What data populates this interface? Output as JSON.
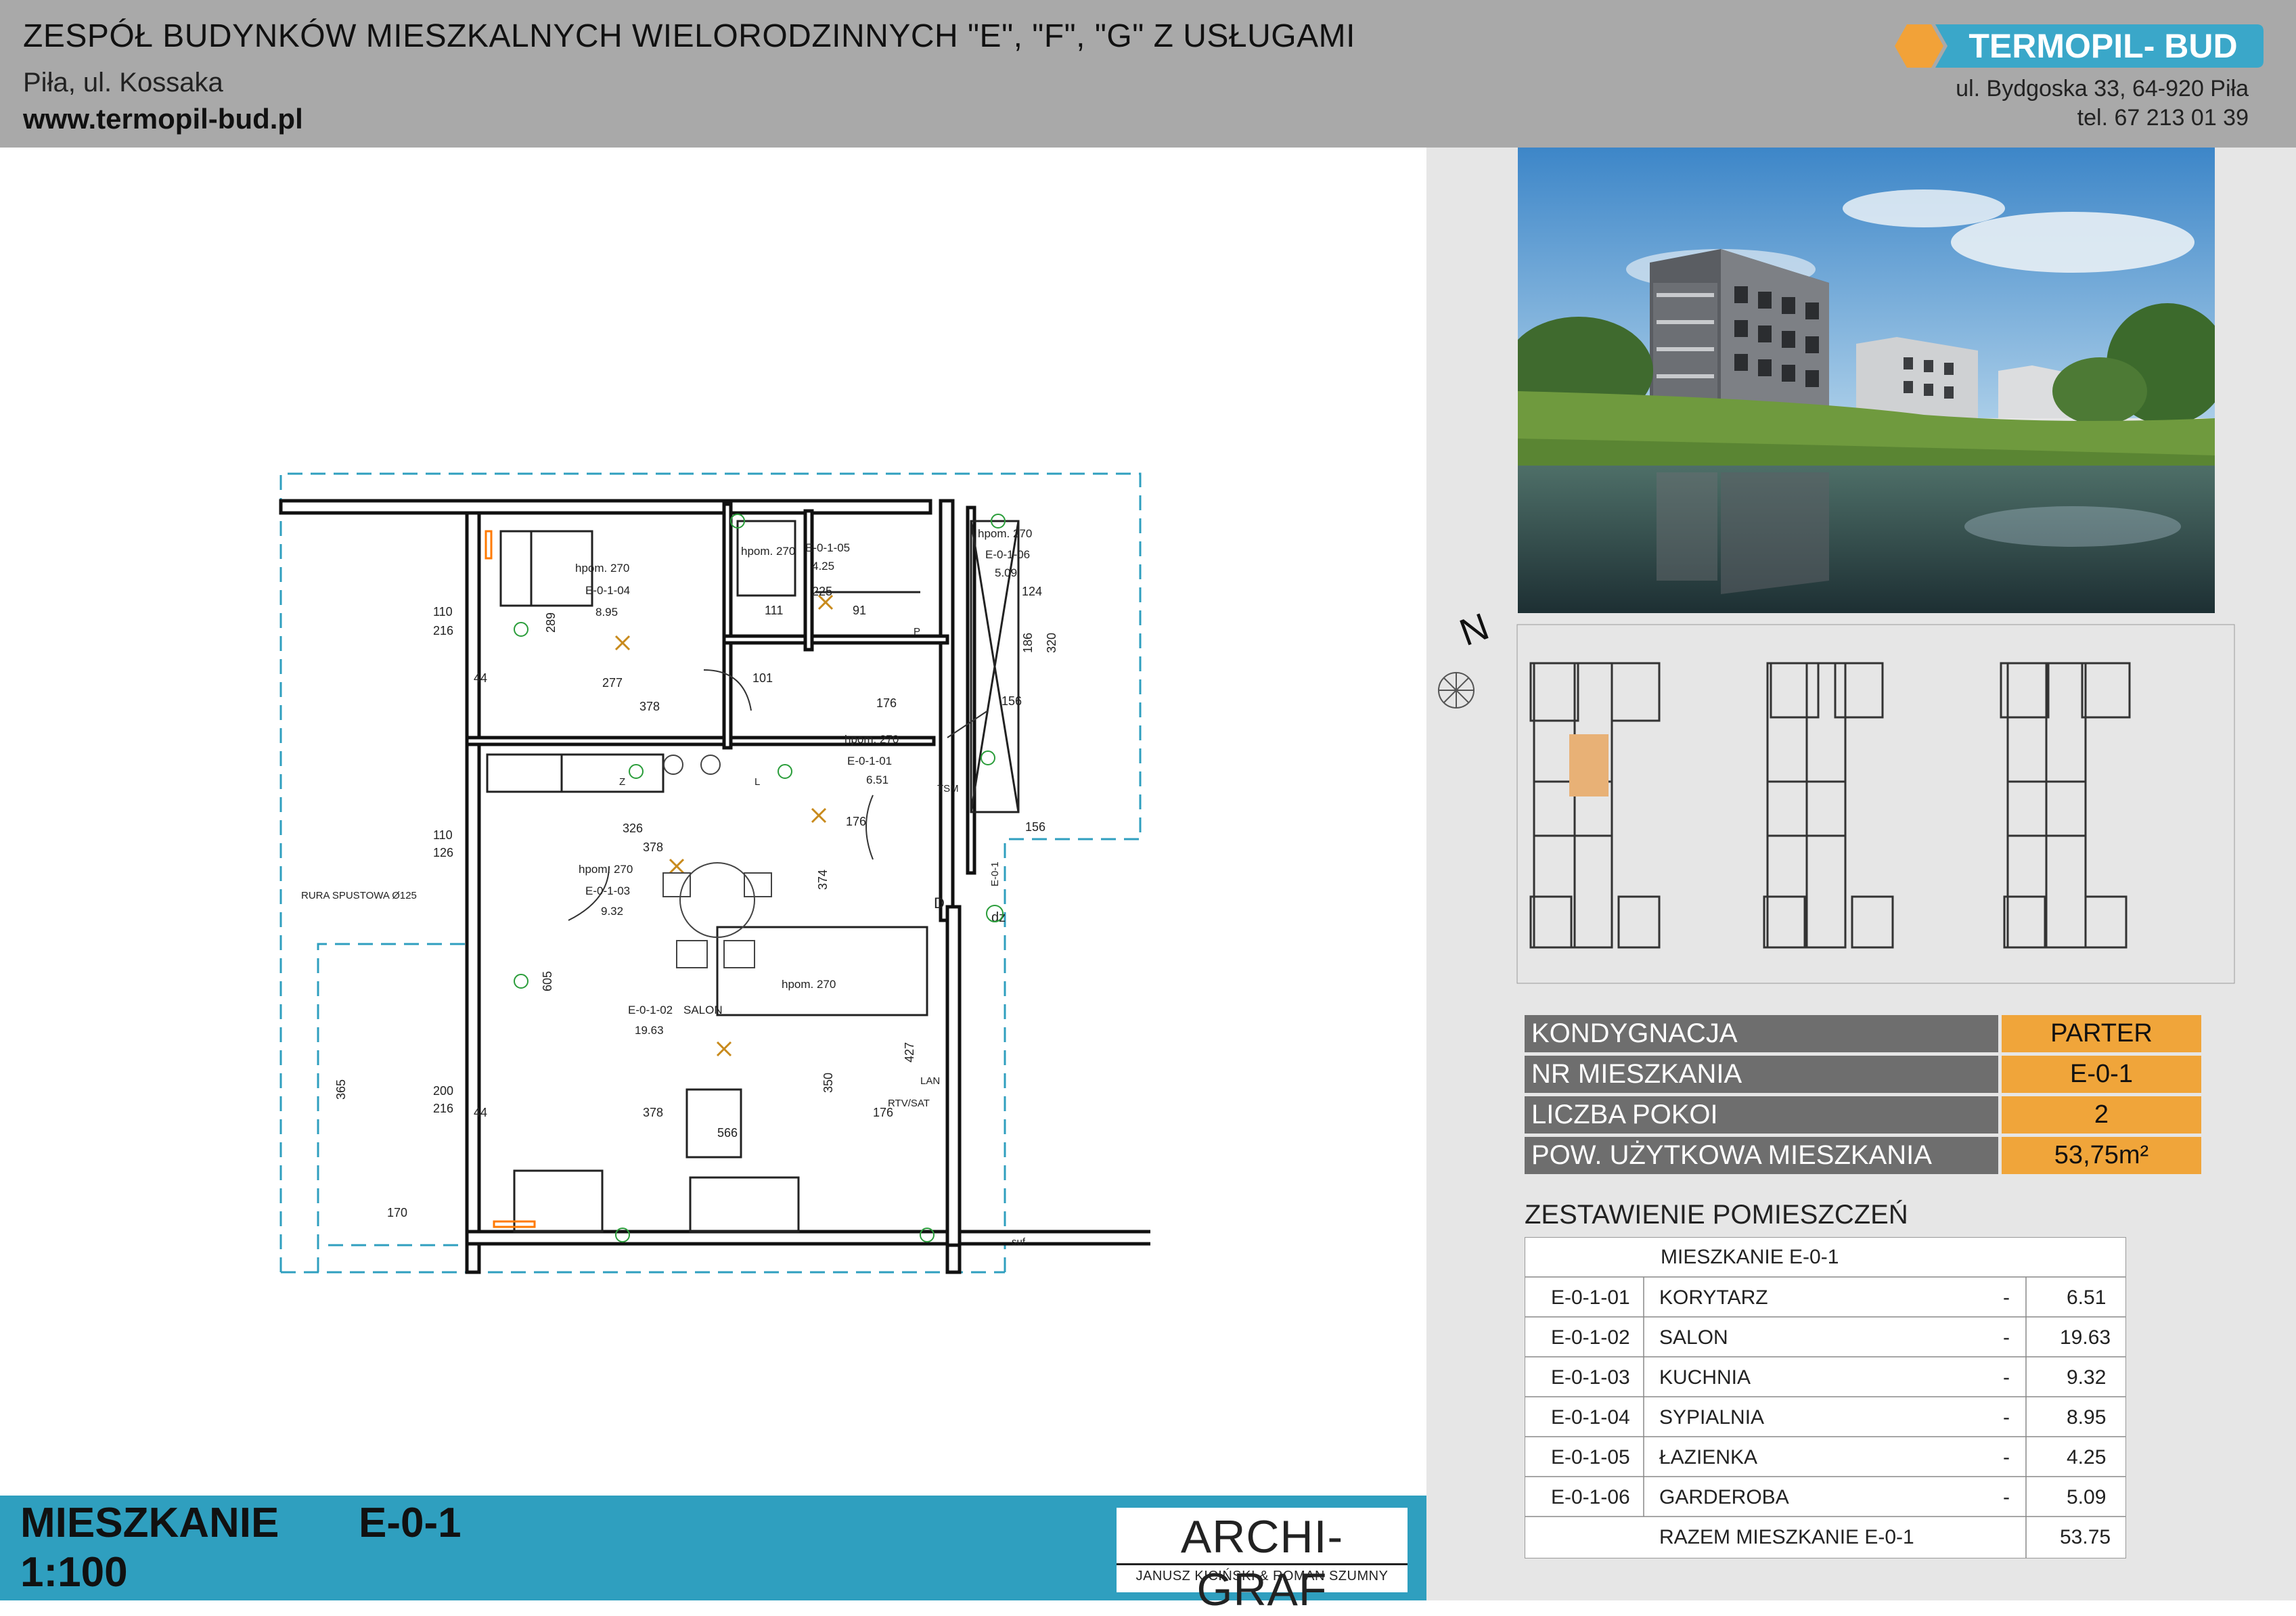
{
  "header": {
    "title": "ZESPÓŁ BUDYNKÓW  MIESZKALNYCH WIELORODZINNYCH \"E\", \"F\", \"G\" Z USŁUGAMI",
    "subtitle": "Piła, ul. Kossaka",
    "url": "www.termopil-bud.pl",
    "logo_text": "TERMOPIL- BUD",
    "address": "ul. Bydgoska 33, 64-920 Piła",
    "phone": "tel. 67 213 01 39"
  },
  "keyplan": {
    "north_label": "N"
  },
  "summary": [
    {
      "label": "KONDYGNACJA",
      "value": "PARTER"
    },
    {
      "label": "NR MIESZKANIA",
      "value": "E-0-1"
    },
    {
      "label": "LICZBA POKOI",
      "value": "2"
    },
    {
      "label": "POW. UŻYTKOWA MIESZKANIA",
      "value": "53,75m²"
    }
  ],
  "rooms_table": {
    "title": "ZESTAWIENIE POMIESZCZEŃ",
    "header": "MIESZKANIE E-0-1",
    "rows": [
      {
        "code": "E-0-1-01",
        "name": "KORYTARZ",
        "dash": "-",
        "area": "6.51"
      },
      {
        "code": "E-0-1-02",
        "name": "SALON",
        "dash": "-",
        "area": "19.63"
      },
      {
        "code": "E-0-1-03",
        "name": "KUCHNIA",
        "dash": "-",
        "area": "9.32"
      },
      {
        "code": "E-0-1-04",
        "name": "SYPIALNIA",
        "dash": "-",
        "area": "8.95"
      },
      {
        "code": "E-0-1-05",
        "name": "ŁAZIENKA",
        "dash": "-",
        "area": "4.25"
      },
      {
        "code": "E-0-1-06",
        "name": "GARDEROBA",
        "dash": "-",
        "area": "5.09"
      }
    ],
    "total_label": "RAZEM MIESZKANIE E-0-1",
    "total": "53.75"
  },
  "footer": {
    "apartment_label": "MIESZKANIE",
    "apartment_code": "E-0-1",
    "scale": "1:100",
    "architect": "ARCHI-GRAF",
    "architect_names": "JANUSZ KICIŃSKI  & ROMAN SZUMNY"
  },
  "plan": {
    "rooms": [
      {
        "code": "E-0-1-04",
        "area": "8.95",
        "height": "hpom. 270"
      },
      {
        "code": "E-0-1-05",
        "area": "4.25",
        "height": "hpom. 270"
      },
      {
        "code": "E-0-1-06",
        "area": "5.09",
        "height": "hpom. 270"
      },
      {
        "code": "E-0-1-01",
        "area": "6.51",
        "height": "hpom. 270"
      },
      {
        "code": "E-0-1-03",
        "area": "9.32",
        "height": "hpom. 270"
      },
      {
        "code": "E-0-1-02",
        "name": "SALON",
        "area": "19.63",
        "height": "hpom. 270"
      }
    ],
    "labels": {
      "rura": "RURA SPUSTOWA Ø125",
      "dim_277": "277",
      "dim_378a": "378",
      "dim_326": "326",
      "dim_378b": "378",
      "dim_378c": "378",
      "dim_566": "566",
      "dim_176a": "176",
      "dim_176b": "176",
      "dim_176c": "176",
      "dim_156a": "156",
      "dim_156b": "156",
      "dim_225": "225",
      "dim_111": "111",
      "dim_91": "91",
      "dim_124": "124",
      "dim_110a": "110",
      "dim_216a": "216",
      "dim_110b": "110",
      "dim_126": "126",
      "dim_200": "200",
      "dim_216b": "216",
      "dim_365": "365",
      "dim_170": "170",
      "dim_374": "374",
      "dim_350": "350",
      "dim_427": "427",
      "dim_605": "605",
      "dim_289": "289",
      "dim_320": "320",
      "dim_186": "186",
      "dim_101": "101",
      "dim_44a": "44",
      "dim_44b": "44",
      "lan": "LAN",
      "rtv": "RTV/SAT",
      "tsm": "TSM",
      "dz": "dz",
      "d": "D",
      "p": "P",
      "z": "Z",
      "l": "L",
      "e01": "E-0-1",
      "suf": "suf"
    }
  }
}
